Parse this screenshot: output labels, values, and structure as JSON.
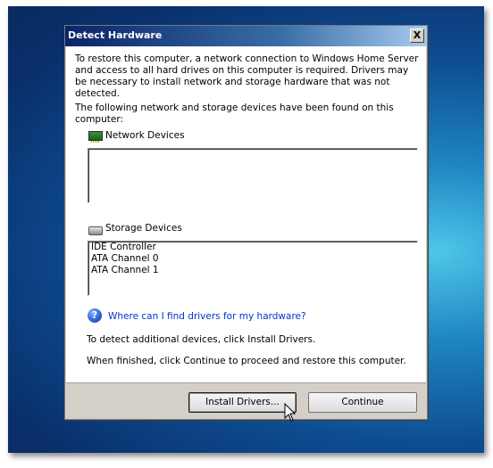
{
  "dialog": {
    "title": "Detect Hardware",
    "close_label": "X"
  },
  "content": {
    "intro_text": "To restore this computer, a network connection to Windows Home Server and access to all hard drives on this computer is required. Drivers may be necessary to install network and storage hardware that was not detected.",
    "found_text": "The following network and storage devices have been found on this computer:",
    "network_group": {
      "icon": "network-adapter-icon",
      "label": "Network Devices",
      "items": []
    },
    "storage_group": {
      "icon": "hard-disk-icon",
      "label": "Storage Devices",
      "items": [
        "IDE Controller",
        "ATA Channel 0",
        "ATA Channel 1"
      ]
    },
    "help_link": {
      "icon": "help-icon",
      "text": "Where can I find drivers for my hardware?"
    },
    "detect_text": "To detect additional devices, click Install Drivers.",
    "finish_text": "When finished, click Continue to proceed and restore this computer."
  },
  "footer": {
    "install_drivers_label": "Install Drivers...",
    "continue_label": "Continue"
  },
  "colors": {
    "title_gradient_start": "#0a246a",
    "title_gradient_end": "#a6caf0",
    "link": "#0033cc",
    "dialog_face": "#d4d0c8"
  }
}
